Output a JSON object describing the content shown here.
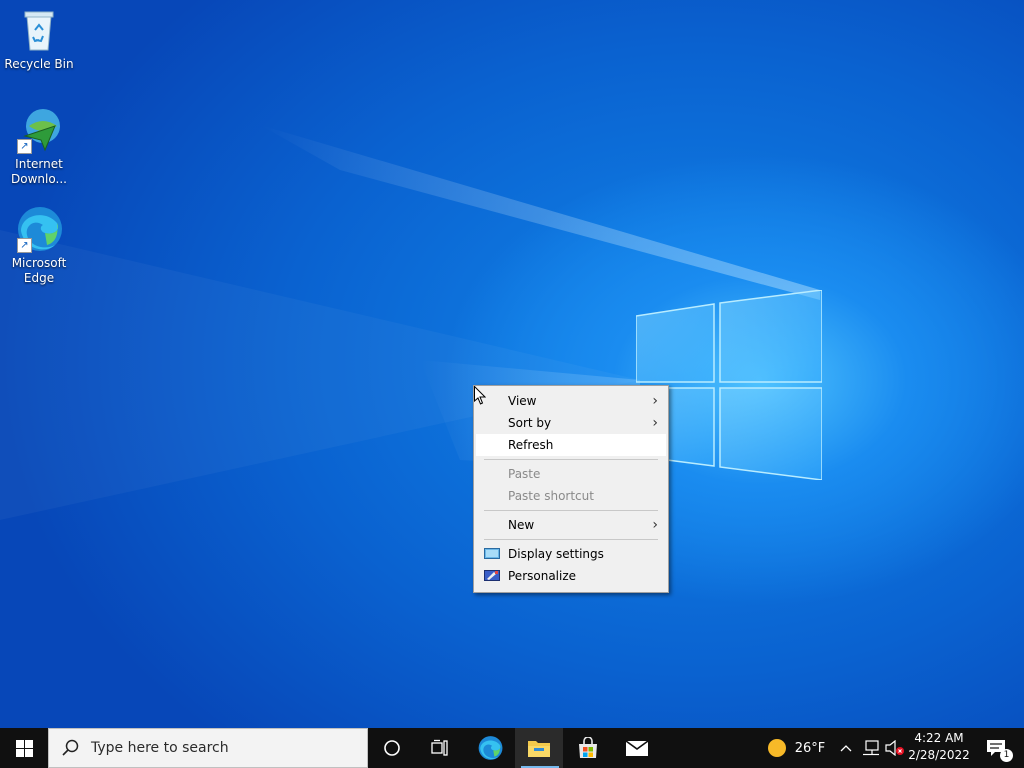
{
  "desktop": {
    "icons": [
      {
        "label": "Recycle Bin",
        "icon": "recycle-bin-icon"
      },
      {
        "label": "Internet Downlo...",
        "icon": "internet-download-manager-icon"
      },
      {
        "label": "Microsoft Edge",
        "icon": "microsoft-edge-icon"
      }
    ]
  },
  "context_menu": {
    "items": [
      {
        "label": "View",
        "submenu": true,
        "enabled": true
      },
      {
        "label": "Sort by",
        "submenu": true,
        "enabled": true
      },
      {
        "label": "Refresh",
        "submenu": false,
        "enabled": true,
        "highlighted": true
      },
      {
        "label": "Paste",
        "submenu": false,
        "enabled": false
      },
      {
        "label": "Paste shortcut",
        "submenu": false,
        "enabled": false
      },
      {
        "label": "New",
        "submenu": true,
        "enabled": true
      },
      {
        "label": "Display settings",
        "submenu": false,
        "enabled": true,
        "icon": "display-icon"
      },
      {
        "label": "Personalize",
        "submenu": false,
        "enabled": true,
        "icon": "personalize-icon"
      }
    ],
    "arrow_glyph": "›"
  },
  "taskbar": {
    "search_placeholder": "Type here to search",
    "pinned": [
      "cortana-icon",
      "task-view-icon",
      "edge-icon",
      "file-explorer-icon",
      "microsoft-store-icon",
      "mail-icon"
    ],
    "weather": {
      "temp": "26°F",
      "icon": "sun-icon"
    },
    "clock": {
      "time": "4:22 AM",
      "date": "2/28/2022"
    },
    "notifications_count": "1",
    "colors": {
      "taskbar": "#101010",
      "accent": "#76b9ed"
    }
  }
}
